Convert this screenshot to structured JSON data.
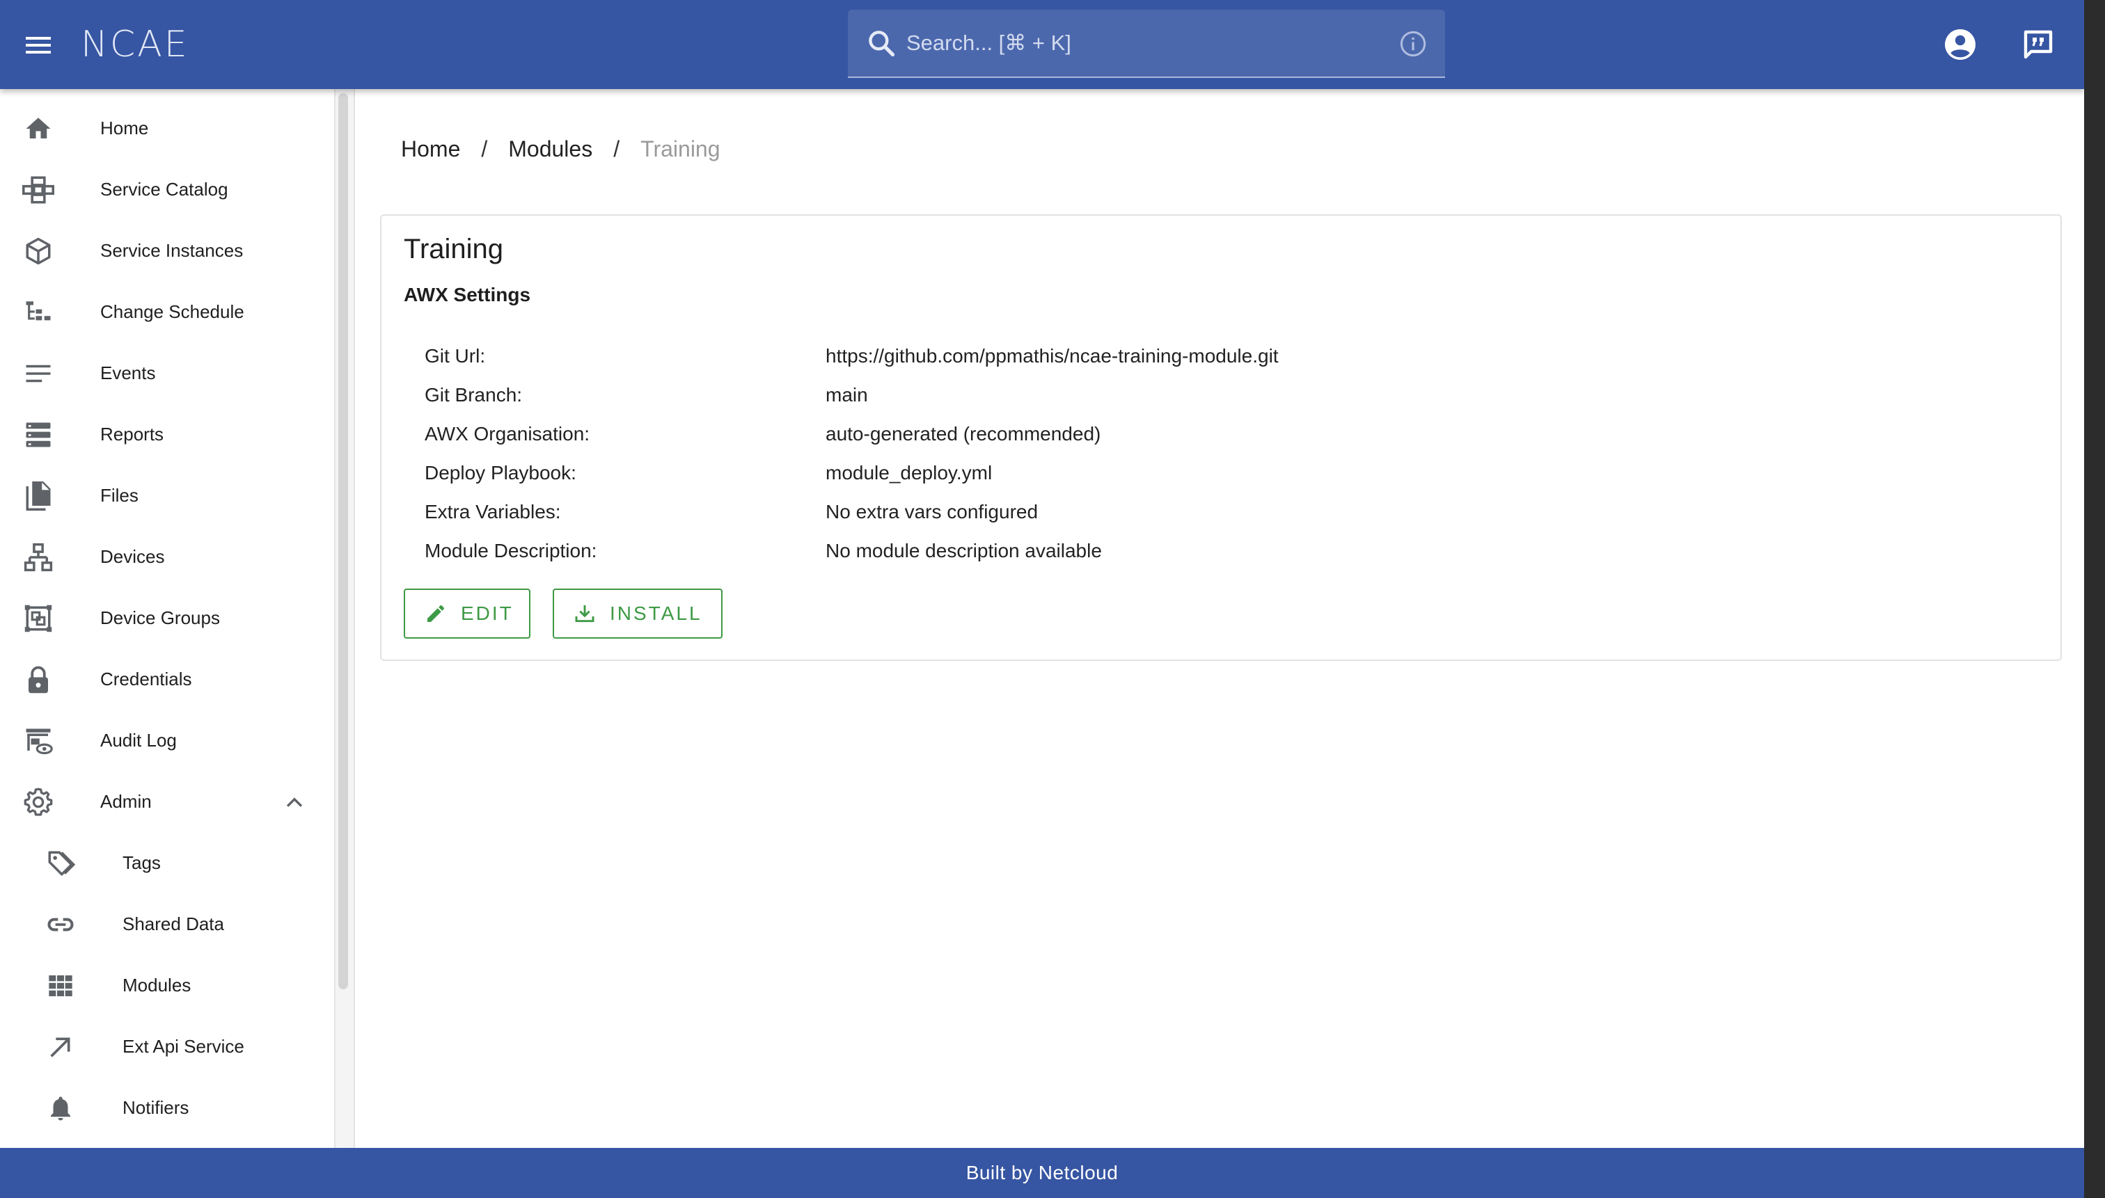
{
  "header": {
    "logo_text": "NCAE",
    "search_placeholder": "Search... [⌘ + K]"
  },
  "sidebar": {
    "items": [
      {
        "label": "Home",
        "icon": "home-icon"
      },
      {
        "label": "Service Catalog",
        "icon": "catalog-icon"
      },
      {
        "label": "Service Instances",
        "icon": "cube-icon"
      },
      {
        "label": "Change Schedule",
        "icon": "schedule-icon"
      },
      {
        "label": "Events",
        "icon": "events-icon"
      },
      {
        "label": "Reports",
        "icon": "reports-icon"
      },
      {
        "label": "Files",
        "icon": "files-icon"
      },
      {
        "label": "Devices",
        "icon": "devices-icon"
      },
      {
        "label": "Device Groups",
        "icon": "device-groups-icon"
      },
      {
        "label": "Credentials",
        "icon": "lock-icon"
      },
      {
        "label": "Audit Log",
        "icon": "audit-log-icon"
      },
      {
        "label": "Admin",
        "icon": "gear-icon"
      }
    ],
    "admin_items": [
      {
        "label": "Tags",
        "icon": "tag-icon"
      },
      {
        "label": "Shared Data",
        "icon": "link-icon"
      },
      {
        "label": "Modules",
        "icon": "grid-icon"
      },
      {
        "label": "Ext Api Service",
        "icon": "arrow-up-right-icon"
      },
      {
        "label": "Notifiers",
        "icon": "bell-icon"
      }
    ]
  },
  "breadcrumb": {
    "items": [
      "Home",
      "Modules"
    ],
    "separator": "/",
    "current": "Training"
  },
  "card": {
    "title": "Training",
    "subtitle": "AWX Settings",
    "fields": [
      {
        "key": "Git Url:",
        "value": "https://github.com/ppmathis/ncae-training-module.git"
      },
      {
        "key": "Git Branch:",
        "value": "main"
      },
      {
        "key": "AWX Organisation:",
        "value": "auto-generated (recommended)"
      },
      {
        "key": "Deploy Playbook:",
        "value": "module_deploy.yml"
      },
      {
        "key": "Extra Variables:",
        "value": "No extra vars configured"
      },
      {
        "key": "Module Description:",
        "value": "No module description available"
      }
    ],
    "edit_label": "EDIT",
    "install_label": "INSTALL"
  },
  "footer": {
    "text": "Built by Netcloud"
  },
  "colors": {
    "primary": "#3655a2",
    "accent_green": "#3d9a45",
    "muted_text": "#9a9a9a"
  }
}
